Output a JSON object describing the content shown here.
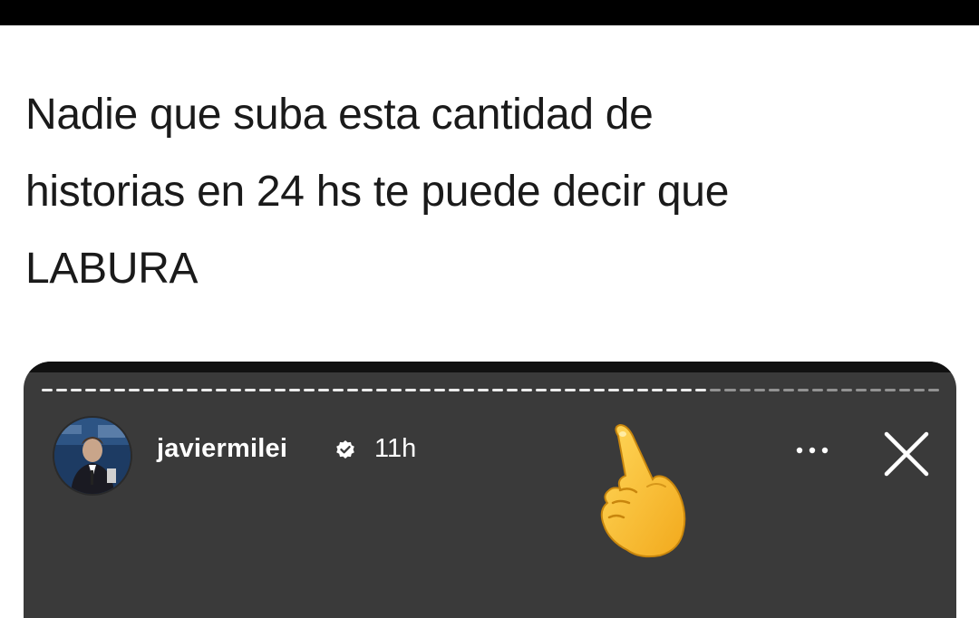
{
  "caption": {
    "line1": "Nadie que suba esta cantidad de",
    "line2": "historias en 24 hs te puede decir que",
    "line3": "LABURA"
  },
  "story": {
    "username": "javiermilei",
    "time": "11h",
    "progress_segments": 62,
    "progress_seen": 46,
    "icons": {
      "verified": "verified-badge-icon",
      "more": "more-options-icon",
      "close": "close-icon",
      "emoji": "pointing-up-emoji-icon"
    }
  },
  "colors": {
    "page_background": "#ffffff",
    "top_bar": "#000000",
    "story_background": "#3a3a3a",
    "caption_text": "#1a1a1a",
    "emoji_yellow": "#f7c33d"
  }
}
